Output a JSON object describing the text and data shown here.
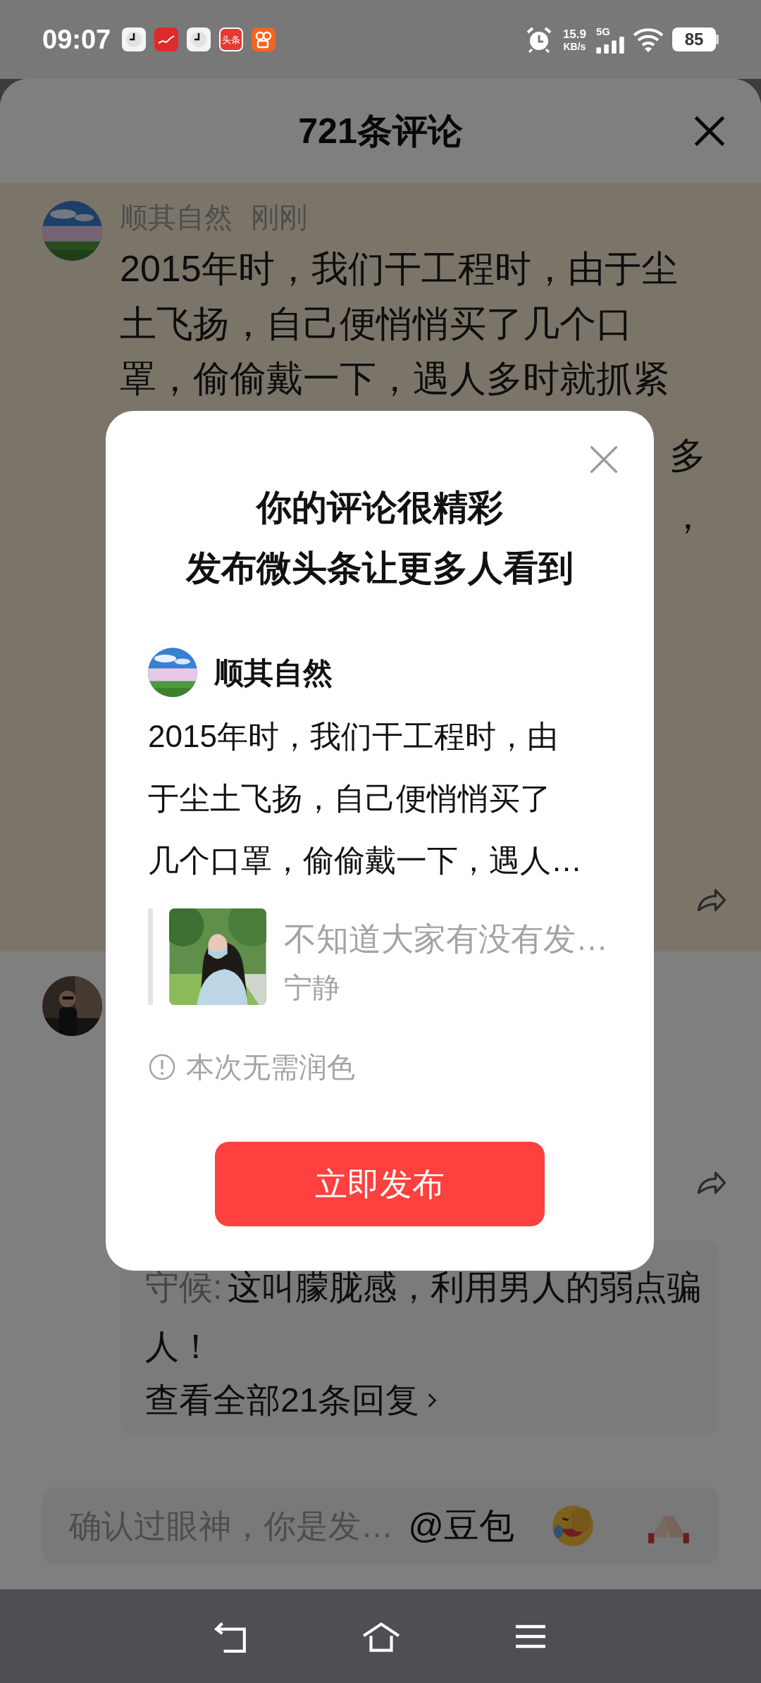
{
  "status_bar": {
    "time": "09:07",
    "notification_icons": [
      {
        "kind": "clock"
      },
      {
        "kind": "chart"
      },
      {
        "kind": "clock"
      },
      {
        "kind": "news",
        "label": "头条"
      },
      {
        "kind": "video"
      }
    ],
    "net_speed": "15.9",
    "net_speed_unit": "KB/s",
    "network": "5G",
    "battery": "85"
  },
  "header": {
    "title": "721条评论"
  },
  "comments": [
    {
      "author": "顺其自然",
      "time": "刚刚",
      "highlighted": true,
      "body_lines": [
        "2015年时，我们干工程时，由于尘",
        "土飞扬，自己便悄悄买了几个口",
        "罩，偷偷戴一下，遇人多时就抓紧"
      ],
      "body_fragments": [
        "多",
        "，"
      ]
    },
    {
      "highlighted": false,
      "reply": {
        "author": "守候:",
        "text": "这叫朦胧感，利用男人的弱点骗人！",
        "view_all": "查看全部21条回复"
      }
    }
  ],
  "input_bar": {
    "placeholder": "确认过眼神，你是发…",
    "mention": "@豆包"
  },
  "dialog": {
    "title_lines": [
      "你的评论很精彩",
      "发布微头条让更多人看到"
    ],
    "author": "顺其自然",
    "text_lines": [
      "2015年时，我们干工程时，由",
      "于尘土飞扬，自己便悄悄买了",
      "几个口罩，偷偷戴一下，遇人…"
    ],
    "quote": {
      "title": "不知道大家有没有发…",
      "author": "宁静"
    },
    "notice": "本次无需润色",
    "publish_button": "立即发布"
  }
}
